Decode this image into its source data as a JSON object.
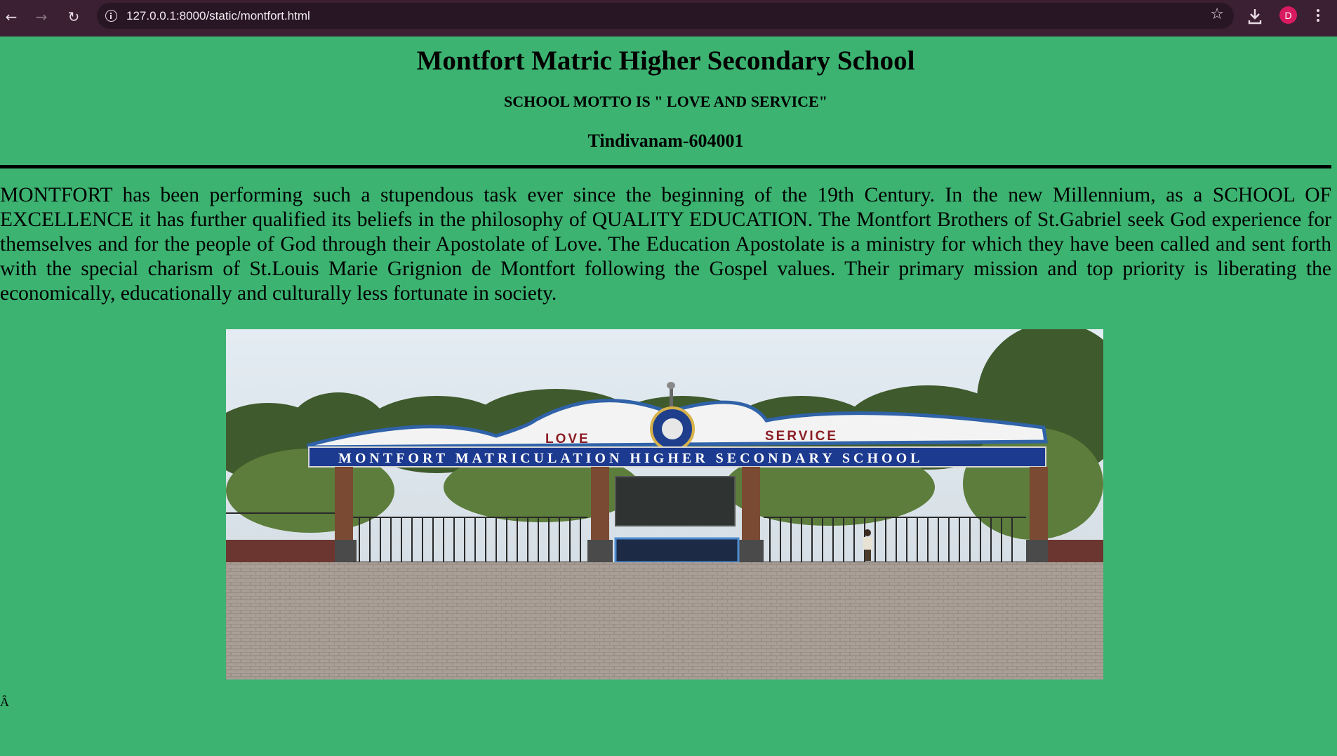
{
  "browser": {
    "url": "127.0.0.1:8000/static/montfort.html",
    "avatar_letter": "D",
    "icons": [
      "back-icon",
      "forward-icon",
      "reload-icon",
      "site-info-icon",
      "bookmark-star-icon",
      "download-icon",
      "menu-kebab-icon"
    ]
  },
  "page": {
    "title": "Montfort Matric Higher Secondary School",
    "motto": "SCHOOL MOTTO IS \" LOVE AND SERVICE\"",
    "location": "Tindivanam-604001",
    "paragraph": "MONTFORT has been performing such a stupendous task ever since the beginning of the 19th Century. In the new Millennium, as a SCHOOL OF EXCELLENCE it has further qualified its beliefs in the philosophy of QUALITY EDUCATION. The Montfort Brothers of St.Gabriel seek God experience for themselves and for the people of God through their Apostolate of Love. The Education Apostolate is a ministry for which they have been called and sent forth with the special charism of St.Louis Marie Grignion de Montfort following the Gospel values. Their primary mission and top priority is liberating the economically, educationally and culturally less fortunate in society.",
    "photo": {
      "arch_left_word": "LOVE",
      "arch_right_word": "SERVICE",
      "banner_text": "MONTFORT MATRICULATION HIGHER SECONDARY SCHOOL"
    },
    "stray_char": "Â"
  },
  "colors": {
    "page_background": "#3cb371",
    "chrome_background": "#3b1f33",
    "avatar": "#d81b60"
  }
}
